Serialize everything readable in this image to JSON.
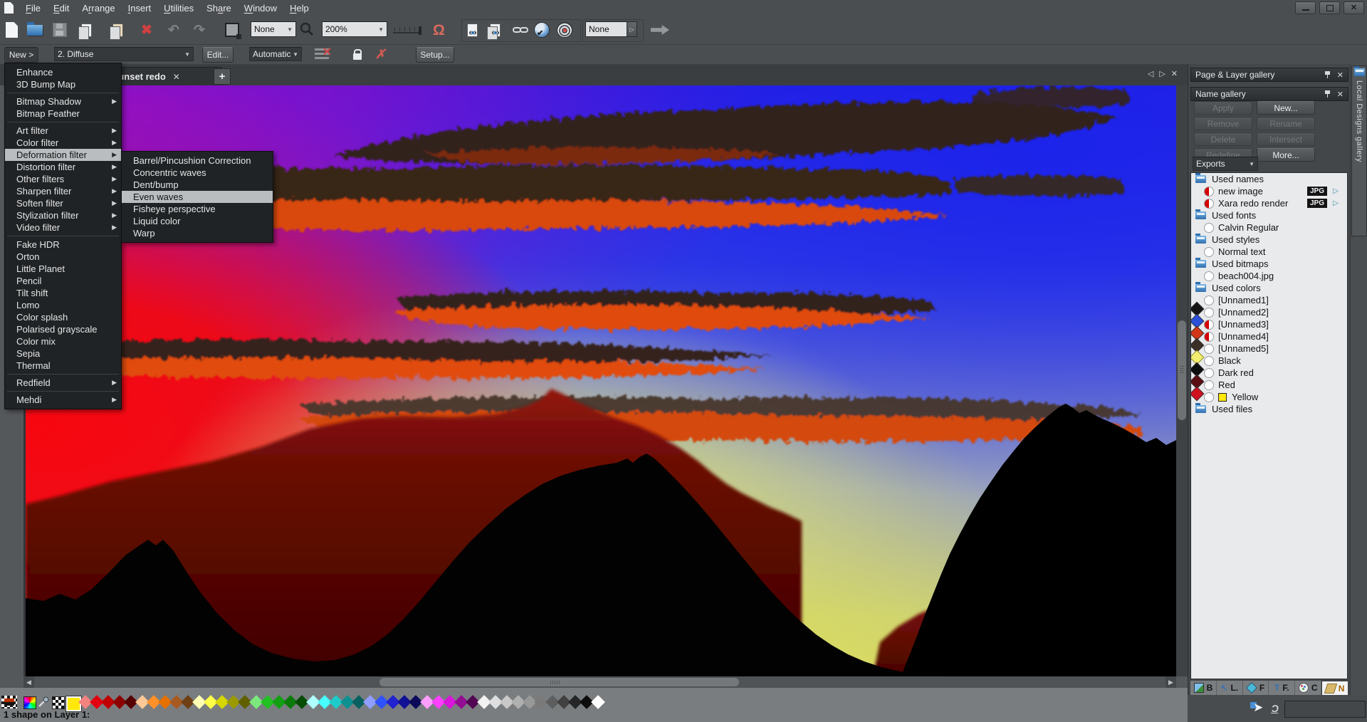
{
  "icons": {
    "delete": "✖",
    "undo": "↶",
    "redo": "↷",
    "magnet": "Ω",
    "dropdown-arrow": "▼",
    "submenu-arrow": "▶",
    "close": "✕",
    "tab-prev": "◁",
    "tab-next": "▷",
    "scroll-left": "◀",
    "scroll-right": "▶",
    "check": "✔",
    "plus": "+",
    "cursor": "➤",
    "snap": "Ɔ",
    "nosnap": "✗",
    "rows-x": "✕"
  },
  "menubar": {
    "items": [
      {
        "label": "File",
        "u": 0
      },
      {
        "label": "Edit",
        "u": 0
      },
      {
        "label": "Arrange",
        "u": 1
      },
      {
        "label": "Insert",
        "u": 0
      },
      {
        "label": "Utilities",
        "u": 0
      },
      {
        "label": "Share",
        "u": 2
      },
      {
        "label": "Window",
        "u": 0
      },
      {
        "label": "Help",
        "u": 0
      }
    ]
  },
  "toolbar": {
    "page_size_value": "None",
    "zoom_value": "200%",
    "export_preset_value": "None"
  },
  "filter_bar": {
    "new_button": "New >",
    "preset_value": "2. Diffuse",
    "edit_button": "Edit...",
    "mode_value": "Automatic",
    "setup_button": "Setup..."
  },
  "tabbar": {
    "active_tab": "mountain sunset redo"
  },
  "effects_menu": {
    "items": [
      {
        "label": "Enhance"
      },
      {
        "label": "3D Bump Map"
      },
      {
        "sep": true
      },
      {
        "label": "Bitmap Shadow",
        "submenu": true
      },
      {
        "label": "Bitmap Feather"
      },
      {
        "sep": true
      },
      {
        "label": "Art filter",
        "submenu": true
      },
      {
        "label": "Color filter",
        "submenu": true
      },
      {
        "label": "Deformation filter",
        "submenu": true,
        "highlighted": true
      },
      {
        "label": "Distortion filter",
        "submenu": true
      },
      {
        "label": "Other filters",
        "submenu": true
      },
      {
        "label": "Sharpen filter",
        "submenu": true
      },
      {
        "label": "Soften filter",
        "submenu": true
      },
      {
        "label": "Stylization filter",
        "submenu": true
      },
      {
        "label": "Video filter",
        "submenu": true
      },
      {
        "sep": true
      },
      {
        "label": "Fake HDR"
      },
      {
        "label": "Orton"
      },
      {
        "label": "Little Planet"
      },
      {
        "label": "Pencil"
      },
      {
        "label": "Tilt shift"
      },
      {
        "label": "Lomo"
      },
      {
        "label": "Color splash"
      },
      {
        "label": "Polarised grayscale"
      },
      {
        "label": "Color mix"
      },
      {
        "label": "Sepia"
      },
      {
        "label": "Thermal"
      },
      {
        "sep": true
      },
      {
        "label": "Redfield",
        "submenu": true
      },
      {
        "sep": true
      },
      {
        "label": "Mehdi",
        "submenu": true
      }
    ]
  },
  "deformation_submenu": {
    "items": [
      {
        "label": "Barrel/Pincushion Correction"
      },
      {
        "label": "Concentric waves"
      },
      {
        "label": "Dent/bump"
      },
      {
        "label": "Even waves",
        "highlighted": true
      },
      {
        "label": "Fisheye perspective"
      },
      {
        "label": "Liquid color"
      },
      {
        "label": "Warp"
      }
    ]
  },
  "right_panel": {
    "page_layer_header": "Page & Layer gallery",
    "name_header": "Name gallery",
    "buttons": [
      {
        "label": "Apply",
        "enabled": false
      },
      {
        "label": "New...",
        "enabled": true
      },
      {
        "label": "Remove",
        "enabled": false
      },
      {
        "label": "Rename",
        "enabled": false
      },
      {
        "label": "Delete",
        "enabled": false
      },
      {
        "label": "Intersect",
        "enabled": false
      },
      {
        "label": "Redefine",
        "enabled": false
      },
      {
        "label": "More...",
        "enabled": true
      }
    ],
    "exports_label": "Exports",
    "tree": [
      {
        "kind": "folder",
        "label": "Used names"
      },
      {
        "kind": "leaf",
        "icon": "half-red",
        "label": "new image",
        "badge": "JPG"
      },
      {
        "kind": "leaf",
        "icon": "half-red",
        "label": "Xara redo render",
        "badge": "JPG"
      },
      {
        "kind": "folder",
        "label": "Used fonts"
      },
      {
        "kind": "leaf",
        "icon": "circle",
        "label": "Calvin Regular"
      },
      {
        "kind": "folder",
        "label": "Used styles"
      },
      {
        "kind": "leaf",
        "icon": "circle",
        "label": "Normal text"
      },
      {
        "kind": "folder",
        "label": "Used bitmaps"
      },
      {
        "kind": "leaf",
        "icon": "circle",
        "label": "beach004.jpg"
      },
      {
        "kind": "folder",
        "label": "Used colors"
      },
      {
        "kind": "leaf",
        "icon": "circle",
        "chip": {
          "shape": "diamond",
          "color": "#141414"
        },
        "label": "[Unnamed1]"
      },
      {
        "kind": "leaf",
        "icon": "circle",
        "chip": {
          "shape": "diamond",
          "color": "#2b50d8"
        },
        "label": "[Unnamed2]"
      },
      {
        "kind": "leaf",
        "icon": "half-red",
        "chip": {
          "shape": "diamond",
          "color": "#d23517"
        },
        "label": "[Unnamed3]"
      },
      {
        "kind": "leaf",
        "icon": "half-red",
        "chip": {
          "shape": "diamond",
          "color": "#3a2f26"
        },
        "label": "[Unnamed4]"
      },
      {
        "kind": "leaf",
        "icon": "circle",
        "chip": {
          "shape": "diamond",
          "color": "#f1ee70",
          "border": "#8a8420"
        },
        "label": "[Unnamed5]"
      },
      {
        "kind": "leaf",
        "icon": "circle",
        "chip": {
          "shape": "diamond",
          "color": "#0d0d0d"
        },
        "label": "Black"
      },
      {
        "kind": "leaf",
        "icon": "circle",
        "chip": {
          "shape": "diamond",
          "color": "#5a0e12"
        },
        "label": "Dark red"
      },
      {
        "kind": "leaf",
        "icon": "circle",
        "chip": {
          "shape": "diamond",
          "color": "#cf1020"
        },
        "label": "Red"
      },
      {
        "kind": "leaf",
        "icon": "circle",
        "chip": {
          "shape": "square",
          "color": "#ffe80a",
          "border": "#222222"
        },
        "label": "Yellow"
      },
      {
        "kind": "folder",
        "label": "Used files"
      }
    ],
    "gallery_tabs": [
      {
        "label": "B",
        "icon": "bitmap"
      },
      {
        "label": "L.",
        "icon": "line"
      },
      {
        "label": "F",
        "icon": "fill"
      },
      {
        "label": "F.",
        "icon": "font"
      },
      {
        "label": "C",
        "icon": "color"
      },
      {
        "label": "N",
        "icon": "name",
        "active": true
      }
    ],
    "side_tab": "Local Designs gallery"
  },
  "palette": {
    "colors": [
      "#f2837f",
      "#e30010",
      "#c00000",
      "#8c0000",
      "#570000",
      "#ffc896",
      "#ff9128",
      "#e67000",
      "#a85a20",
      "#6e4014",
      "#ffffb4",
      "#ffff48",
      "#d6d600",
      "#9a9a00",
      "#606000",
      "#7de87d",
      "#22c122",
      "#12a012",
      "#0a7a0a",
      "#064d06",
      "#b0ffff",
      "#48ffff",
      "#1fcaca",
      "#0e9090",
      "#0a6060",
      "#8f9eff",
      "#2f52ff",
      "#2222d0",
      "#111195",
      "#0a0a58",
      "#ff9eff",
      "#ff40ff",
      "#d916d9",
      "#930d93",
      "#520552",
      "#f2f2f2",
      "#dedede",
      "#c8c8c8",
      "#b0b0b0",
      "#989898",
      "#7a7a7a",
      "#5e5e5e",
      "#414141",
      "#262626",
      "#0d0d0d",
      "#ffffff"
    ]
  },
  "statusbar": {
    "message": "1 shape on Layer 1:"
  }
}
